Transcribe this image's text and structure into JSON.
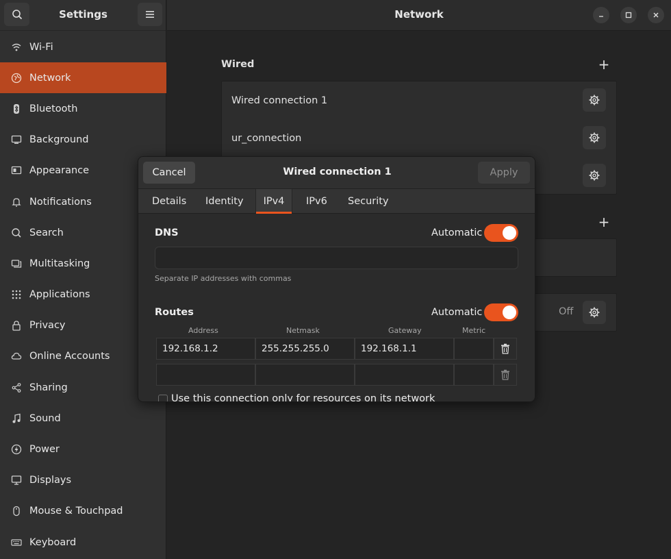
{
  "sidebar": {
    "title": "Settings",
    "items": [
      {
        "label": "Wi-Fi",
        "icon": "wifi-icon"
      },
      {
        "label": "Network",
        "icon": "network-icon"
      },
      {
        "label": "Bluetooth",
        "icon": "bluetooth-icon"
      },
      {
        "label": "Background",
        "icon": "background-icon"
      },
      {
        "label": "Appearance",
        "icon": "appearance-icon"
      },
      {
        "label": "Notifications",
        "icon": "bell-icon"
      },
      {
        "label": "Search",
        "icon": "search-icon"
      },
      {
        "label": "Multitasking",
        "icon": "multitasking-icon"
      },
      {
        "label": "Applications",
        "icon": "grid-icon"
      },
      {
        "label": "Privacy",
        "icon": "lock-icon"
      },
      {
        "label": "Online Accounts",
        "icon": "cloud-icon"
      },
      {
        "label": "Sharing",
        "icon": "share-icon"
      },
      {
        "label": "Sound",
        "icon": "music-note-icon"
      },
      {
        "label": "Power",
        "icon": "power-icon"
      },
      {
        "label": "Displays",
        "icon": "display-icon"
      },
      {
        "label": "Mouse & Touchpad",
        "icon": "mouse-icon"
      },
      {
        "label": "Keyboard",
        "icon": "keyboard-icon"
      }
    ]
  },
  "main": {
    "title": "Network",
    "wired_label": "Wired",
    "connections": [
      "Wired connection 1",
      "ur_connection",
      ""
    ],
    "proxy_status": "Off"
  },
  "dialog": {
    "title": "Wired connection 1",
    "cancel_label": "Cancel",
    "apply_label": "Apply",
    "tabs": [
      "Details",
      "Identity",
      "IPv4",
      "IPv6",
      "Security"
    ],
    "active_tab": "IPv4",
    "dns_label": "DNS",
    "dns_auto_label": "Automatic",
    "dns_value": "",
    "dns_hint": "Separate IP addresses with commas",
    "routes_label": "Routes",
    "routes_auto_label": "Automatic",
    "route_columns": [
      "Address",
      "Netmask",
      "Gateway",
      "Metric"
    ],
    "routes": [
      {
        "address": "192.168.1.2",
        "netmask": "255.255.255.0",
        "gateway": "192.168.1.1",
        "metric": ""
      },
      {
        "address": "",
        "netmask": "",
        "gateway": "",
        "metric": ""
      }
    ],
    "only_resources_label": "Use this connection only for resources on its network"
  },
  "colors": {
    "accent": "#e9541e",
    "sidebar_active": "#b8471f"
  }
}
